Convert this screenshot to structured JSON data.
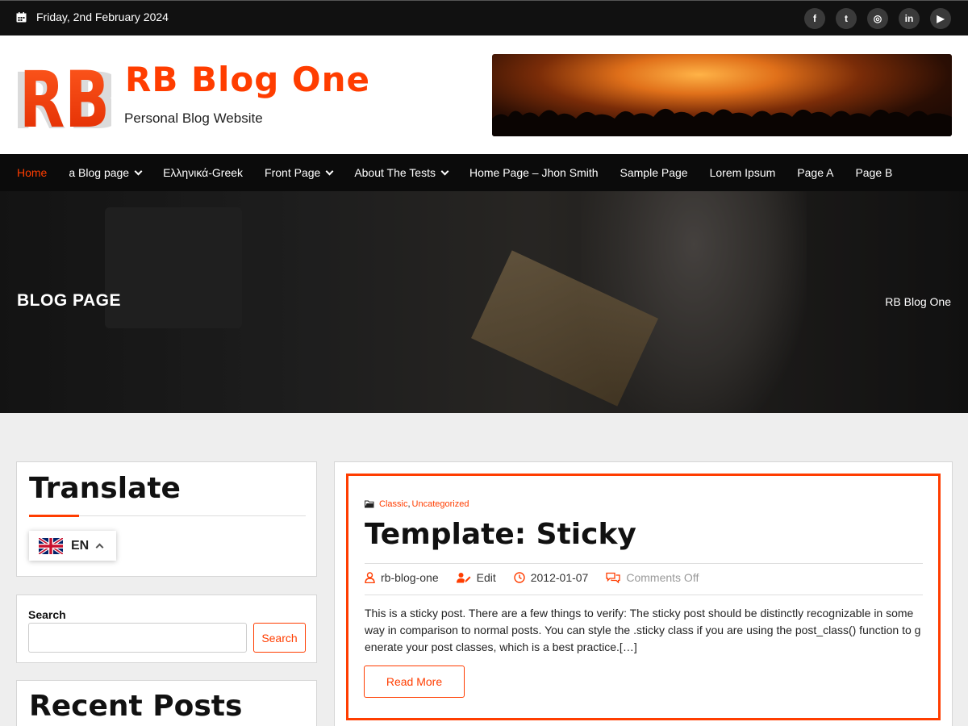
{
  "topbar": {
    "date": "Friday, 2nd February 2024",
    "social": [
      {
        "icon": "facebook-icon",
        "glyph": "f"
      },
      {
        "icon": "twitter-icon",
        "glyph": "t"
      },
      {
        "icon": "instagram-icon",
        "glyph": "◎"
      },
      {
        "icon": "linkedin-icon",
        "glyph": "in"
      },
      {
        "icon": "youtube-icon",
        "glyph": "▶"
      }
    ]
  },
  "header": {
    "logo_text": "RB",
    "site_title": "RB Blog One",
    "tagline": "Personal Blog Website"
  },
  "nav": {
    "items": [
      {
        "label": "Home",
        "active": true,
        "dropdown": false
      },
      {
        "label": "a Blog page",
        "dropdown": true
      },
      {
        "label": "Ελληνικά-Greek",
        "dropdown": false
      },
      {
        "label": "Front Page",
        "dropdown": true
      },
      {
        "label": "About The Tests",
        "dropdown": true
      },
      {
        "label": "Home Page – Jhon Smith",
        "dropdown": false
      },
      {
        "label": "Sample Page",
        "dropdown": false
      },
      {
        "label": "Lorem Ipsum",
        "dropdown": false
      },
      {
        "label": "Page A",
        "dropdown": false
      },
      {
        "label": "Page B",
        "dropdown": false
      }
    ]
  },
  "hero": {
    "title": "BLOG PAGE",
    "breadcrumb": "RB Blog One"
  },
  "sidebar": {
    "translate": {
      "title": "Translate",
      "language_code": "EN"
    },
    "search": {
      "label": "Search",
      "button": "Search",
      "value": "",
      "placeholder": ""
    },
    "recent": {
      "title": "Recent Posts"
    }
  },
  "post": {
    "categories": [
      "Classic",
      "Uncategorized"
    ],
    "title": "Template: Sticky",
    "author": "rb-blog-one",
    "edit": "Edit",
    "date": "2012-01-07",
    "comments": "Comments Off",
    "excerpt": "This is a sticky post. There are a few things to verify: The sticky post should be distinctly recognizable in some way in comparison to normal posts. You can style the .sticky class if you are using the post_class() function to generate your post classes, which is a best practice.[…]",
    "read_more": "Read More"
  },
  "colors": {
    "accent": "#ff3d00",
    "dark": "#111111",
    "page_bg": "#eeeeee"
  }
}
